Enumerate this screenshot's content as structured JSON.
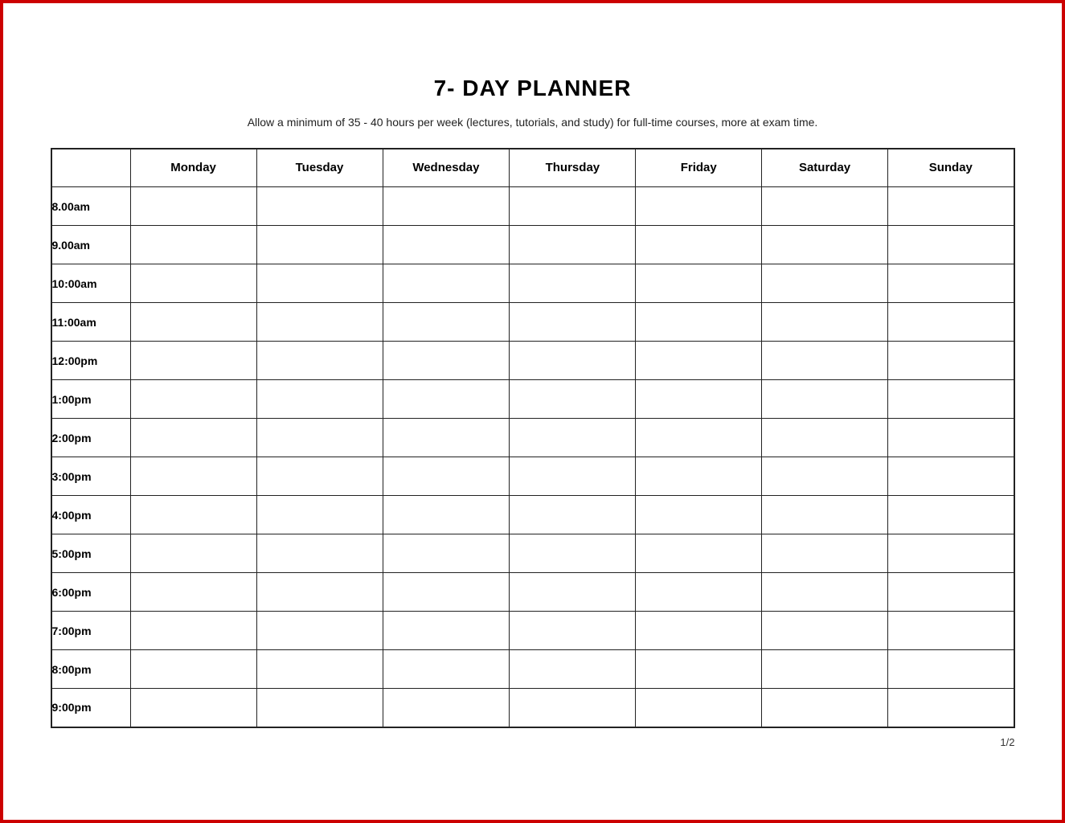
{
  "title": "7- DAY PLANNER",
  "subtitle": "Allow a minimum of 35 - 40 hours per week (lectures, tutorials, and study) for full-time courses, more at exam time.",
  "columns": [
    "",
    "Monday",
    "Tuesday",
    "Wednesday",
    "Thursday",
    "Friday",
    "Saturday",
    "Sunday"
  ],
  "time_slots": [
    "8.00am",
    "9.00am",
    "10:00am",
    "11:00am",
    "12:00pm",
    "1:00pm",
    "2:00pm",
    "3:00pm",
    "4:00pm",
    "5:00pm",
    "6:00pm",
    "7:00pm",
    "8:00pm",
    "9:00pm"
  ],
  "page_number": "1/2"
}
